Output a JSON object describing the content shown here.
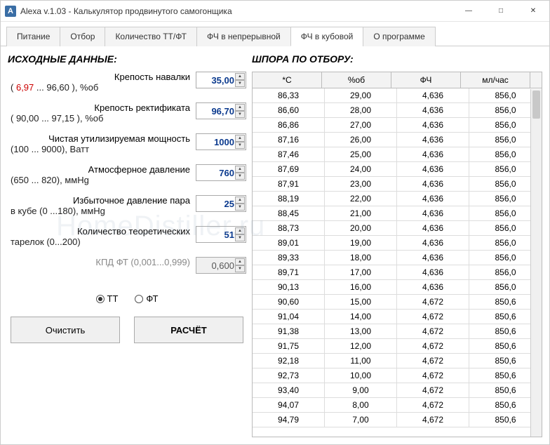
{
  "window": {
    "title": "Alexa  v.1.03 - Калькулятор продвинутого самогонщика"
  },
  "tabs": [
    {
      "label": "Питание"
    },
    {
      "label": "Отбор"
    },
    {
      "label": "Количество ТТ/ФТ"
    },
    {
      "label": "ФЧ в непрерывной"
    },
    {
      "label": "ФЧ в кубовой"
    },
    {
      "label": "О программе"
    }
  ],
  "active_tab_index": 4,
  "left": {
    "title": "ИСХОДНЫЕ ДАННЫЕ:",
    "fields": {
      "nav_strength": {
        "label": "Крепость навалки",
        "range_prefix": "(",
        "range_a": "6,97",
        "range_mid": "  ...     96,60    ), %об",
        "value": "35,00"
      },
      "rect_strength": {
        "label": "Крепость ректификата",
        "range": "(      90,00        ... 97,15 ), %об",
        "value": "96,70"
      },
      "power": {
        "label": "Чистая утилизируемая мощность",
        "range": "(100 ... 9000), Ватт",
        "value": "1000"
      },
      "pressure": {
        "label": "Атмосферное давление",
        "range": "(650 ... 820), ммHg",
        "value": "760"
      },
      "overpressure": {
        "label": "Избыточное давление пара",
        "range": "в кубе (0 ...180), ммHg",
        "value": "25"
      },
      "plates": {
        "label": "Количество   теоретических",
        "range": "тарелок (0...200)",
        "value": "51"
      },
      "kpd": {
        "label": "КПД ФТ (0,001...0,999)",
        "value": "0,600",
        "disabled": true
      }
    },
    "radio": {
      "tt": "ТТ",
      "ft": "ФТ",
      "selected": "tt"
    },
    "buttons": {
      "clear": "Очистить",
      "calc": "РАСЧЁТ"
    }
  },
  "right": {
    "title": "ШПОРА ПО ОТБОРУ:",
    "headers": [
      "*С",
      "%об",
      "ФЧ",
      "мл/час"
    ],
    "rows": [
      [
        "86,33",
        "29,00",
        "4,636",
        "856,0"
      ],
      [
        "86,60",
        "28,00",
        "4,636",
        "856,0"
      ],
      [
        "86,86",
        "27,00",
        "4,636",
        "856,0"
      ],
      [
        "87,16",
        "26,00",
        "4,636",
        "856,0"
      ],
      [
        "87,46",
        "25,00",
        "4,636",
        "856,0"
      ],
      [
        "87,69",
        "24,00",
        "4,636",
        "856,0"
      ],
      [
        "87,91",
        "23,00",
        "4,636",
        "856,0"
      ],
      [
        "88,19",
        "22,00",
        "4,636",
        "856,0"
      ],
      [
        "88,45",
        "21,00",
        "4,636",
        "856,0"
      ],
      [
        "88,73",
        "20,00",
        "4,636",
        "856,0"
      ],
      [
        "89,01",
        "19,00",
        "4,636",
        "856,0"
      ],
      [
        "89,33",
        "18,00",
        "4,636",
        "856,0"
      ],
      [
        "89,71",
        "17,00",
        "4,636",
        "856,0"
      ],
      [
        "90,13",
        "16,00",
        "4,636",
        "856,0"
      ],
      [
        "90,60",
        "15,00",
        "4,672",
        "850,6"
      ],
      [
        "91,04",
        "14,00",
        "4,672",
        "850,6"
      ],
      [
        "91,38",
        "13,00",
        "4,672",
        "850,6"
      ],
      [
        "91,75",
        "12,00",
        "4,672",
        "850,6"
      ],
      [
        "92,18",
        "11,00",
        "4,672",
        "850,6"
      ],
      [
        "92,73",
        "10,00",
        "4,672",
        "850,6"
      ],
      [
        "93,40",
        "9,00",
        "4,672",
        "850,6"
      ],
      [
        "94,07",
        "8,00",
        "4,672",
        "850,6"
      ],
      [
        "94,79",
        "7,00",
        "4,672",
        "850,6"
      ]
    ]
  },
  "watermark": "HomeDistiller.ru"
}
